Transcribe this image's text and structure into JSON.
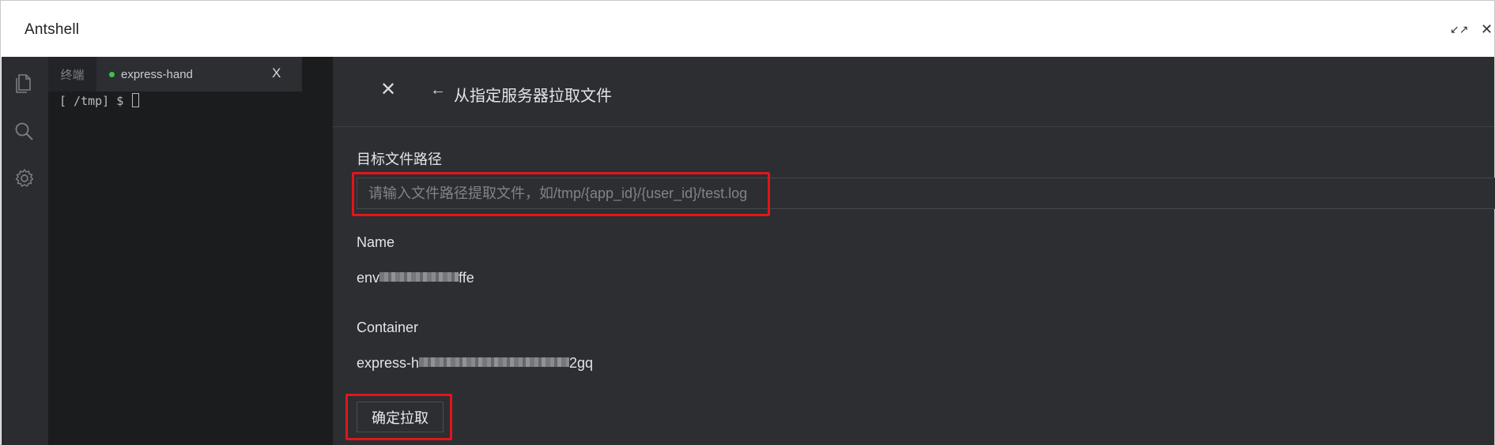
{
  "app": {
    "title": "Antshell",
    "collapse_glyph": "↙↗",
    "close_glyph": "✕"
  },
  "activity_bar": {
    "icons": [
      "files-icon",
      "search-icon",
      "gear-icon"
    ]
  },
  "tabs": {
    "terminal_label": "终端",
    "active_label": "express-hand",
    "active_close": "X",
    "active_dot_color": "#3fbf4f"
  },
  "terminal": {
    "prompt": "[ /tmp] $ "
  },
  "panel": {
    "close_glyph": "✕",
    "back_glyph": "←",
    "title": "从指定服务器拉取文件",
    "path_label": "目标文件路径",
    "path_value": "",
    "path_placeholder": "请输入文件路径提取文件，如/tmp/{app_id}/{user_id}/test.log",
    "name_label": "Name",
    "name_prefix": "env",
    "name_suffix": "ffe",
    "container_label": "Container",
    "container_prefix": "express-h",
    "container_suffix": "2gq",
    "confirm_label": "确定拉取"
  },
  "colors": {
    "highlight": "#e3141b",
    "panel_bg": "#2c2e31",
    "editor_bg": "#1b1c1e",
    "activity_bg": "#2a2c2f"
  }
}
